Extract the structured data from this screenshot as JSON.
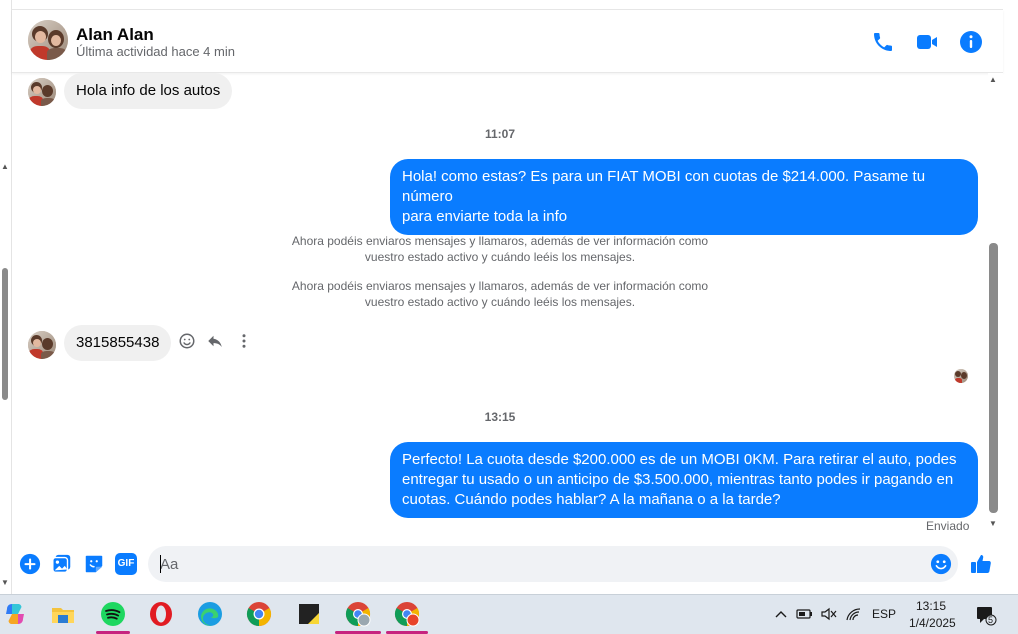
{
  "header": {
    "contact_name": "Alan Alan",
    "status": "Última actividad hace 4 min",
    "icons": [
      "phone-icon",
      "video-camera-icon",
      "info-icon"
    ]
  },
  "messages": {
    "incoming_1": "Hola info de los autos",
    "time_1": "11:07",
    "outgoing_1_line1": "Hola! como estas? Es para un FIAT MOBI con cuotas de $214.000. Pasame tu número",
    "outgoing_1_line2": "para enviarte toda la info",
    "notice_1_line1": "Ahora podéis enviaros mensajes y llamaros, además de ver información como",
    "notice_1_line2": "vuestro estado activo y cuándo leéis los mensajes.",
    "notice_2_line1": "Ahora podéis enviaros mensajes y llamaros, además de ver información como",
    "notice_2_line2": "vuestro estado activo y cuándo leéis los mensajes.",
    "incoming_2": "3815855438",
    "time_2": "13:15",
    "outgoing_2_line1": "Perfecto! La cuota desde $200.000 es de un MOBI 0KM. Para retirar el auto, podes",
    "outgoing_2_line2": "entregar tu usado o un anticipo de $3.500.000, mientras tanto podes ir pagando en",
    "outgoing_2_line3": "cuotas. Cuándo podes hablar? A la mañana o a la tarde?",
    "sent_status": "Enviado"
  },
  "composer": {
    "placeholder": "Aa",
    "icons": [
      "add-icon",
      "image-icon",
      "sticker-icon",
      "gif-icon",
      "emoji-icon",
      "like-icon"
    ],
    "gif_label": "GIF"
  },
  "taskbar": {
    "apps": [
      "copilot-icon",
      "file-explorer-icon",
      "spotify-icon",
      "opera-icon",
      "edge-icon",
      "chrome-icon",
      "sticky-notes-icon",
      "chrome-profile-icon",
      "chrome-profile-2-icon"
    ],
    "language": "ESP",
    "time": "13:15",
    "date": "1/4/2025",
    "notification_count": "5"
  },
  "colors": {
    "accent": "#0a7cff",
    "bubble_in": "#f0f0f0",
    "text_secondary": "#65676b"
  }
}
